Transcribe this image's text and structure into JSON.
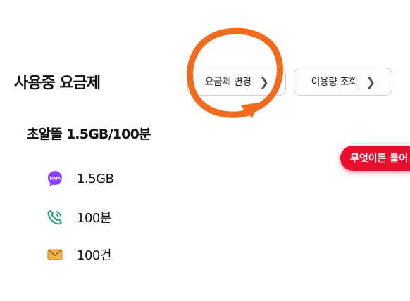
{
  "header": {
    "title": "사용중 요금제",
    "change_plan_label": "요금제 변경",
    "usage_label": "이용량 조회"
  },
  "plan": {
    "name": "초알뜰 1.5GB/100분",
    "items": [
      {
        "icon": "data-icon",
        "value": "1.5GB",
        "icon_text": "DATA"
      },
      {
        "icon": "phone-icon",
        "value": "100분"
      },
      {
        "icon": "message-icon",
        "value": "100건"
      }
    ]
  },
  "chat_button": {
    "label": "무엇이든 물어"
  },
  "colors": {
    "annotation": "#f26a1b",
    "chat": "#e8102e",
    "data_icon": "#8a3ffc",
    "phone_icon": "#1aa37a",
    "message_icon": "#f5b447"
  }
}
